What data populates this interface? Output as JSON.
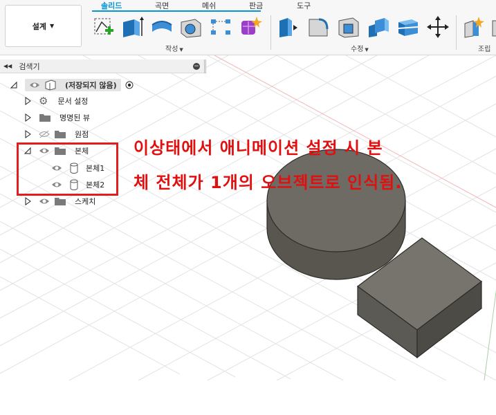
{
  "toolbar": {
    "design_label": "설계",
    "tabs": [
      "솔리드",
      "곡면",
      "메쉬",
      "판금",
      "도구"
    ],
    "groups": {
      "create": "작성",
      "modify": "수정",
      "assemble": "조립"
    }
  },
  "browser": {
    "title": "검색기",
    "root_label": "(저장되지 않음)",
    "items": [
      {
        "label": "문서 설정",
        "icon": "gear-icon"
      },
      {
        "label": "명명된 뷰",
        "icon": "folder-icon"
      },
      {
        "label": "원점",
        "icon": "folder-icon"
      },
      {
        "label": "본체",
        "icon": "folder-icon"
      },
      {
        "label": "본체1",
        "icon": "body-icon"
      },
      {
        "label": "본체2",
        "icon": "body-icon"
      },
      {
        "label": "스케치",
        "icon": "folder-icon"
      }
    ]
  },
  "annotation": {
    "line1": "이상태에서 애니메이션 설정 시 본",
    "line2": "체 전체가 1개의 오브젝트로 인식됨."
  },
  "colors": {
    "accent": "#0696d7",
    "annotation": "#e01010",
    "solid_face": "#6b6862"
  }
}
